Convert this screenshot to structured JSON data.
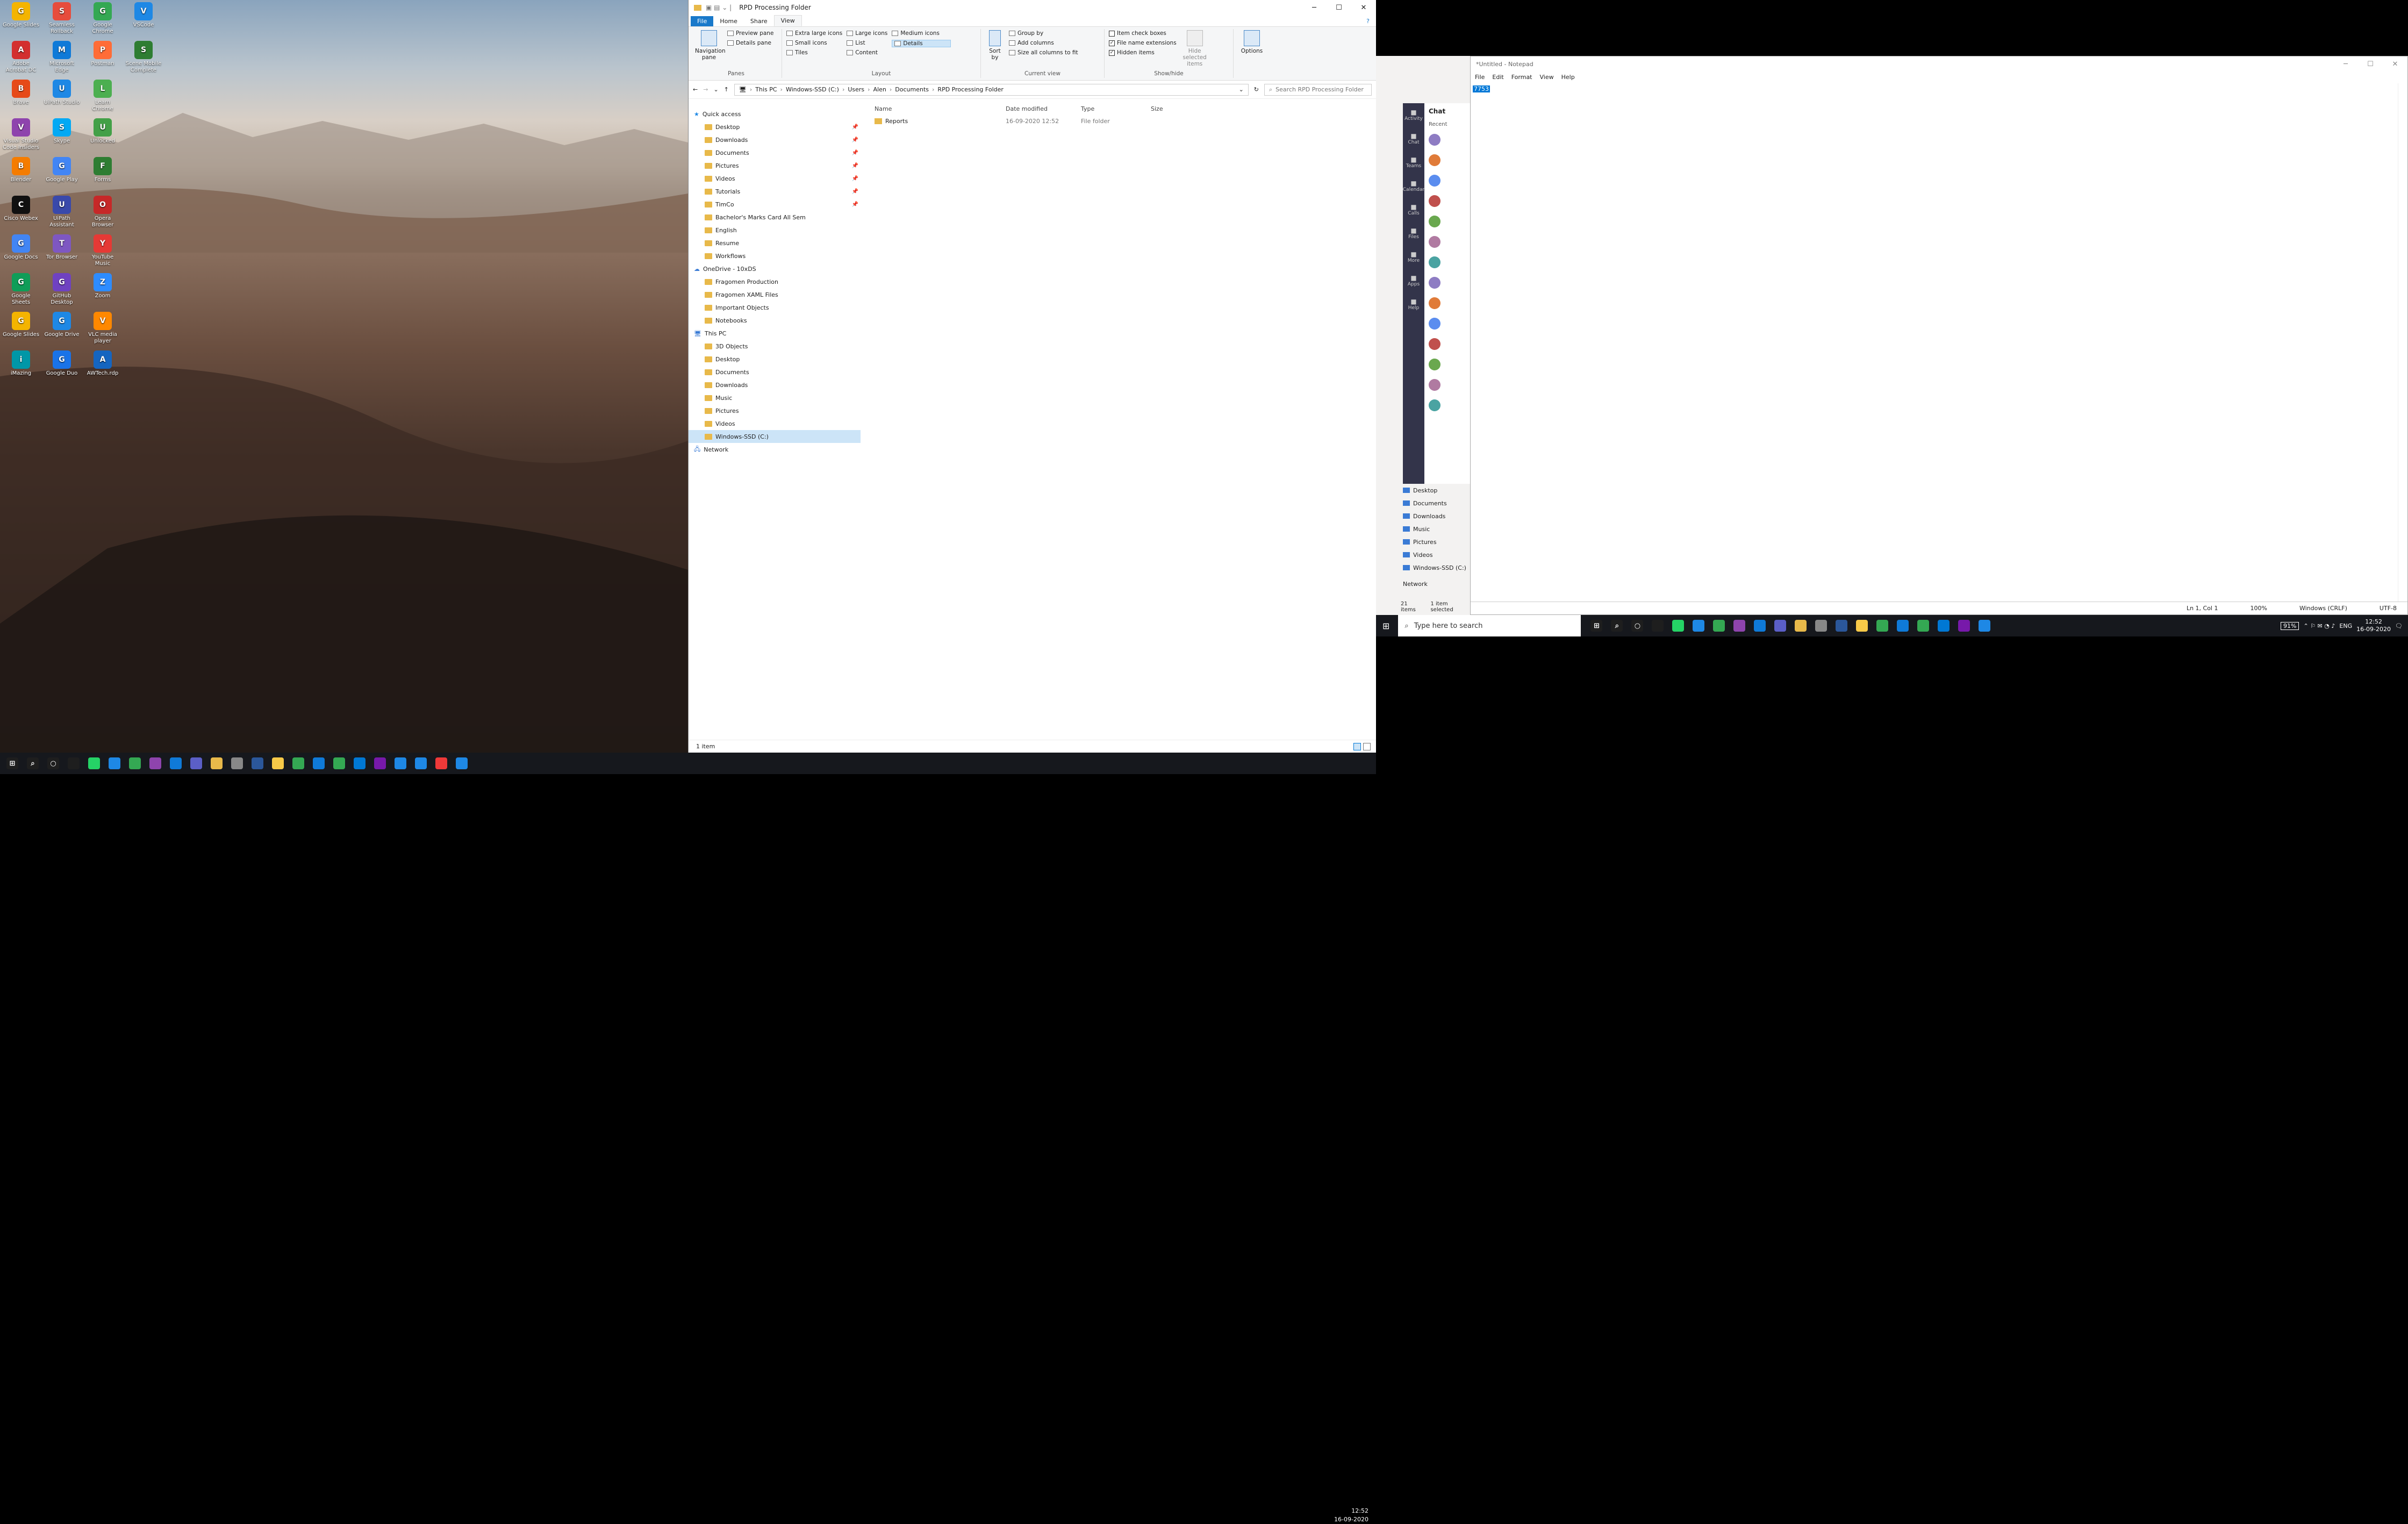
{
  "desktop": {
    "icons": [
      {
        "label": "Google Slides",
        "color": "#f4b400"
      },
      {
        "label": "Seamless Rollback",
        "color": "#e74c3c"
      },
      {
        "label": "Google Chrome",
        "color": "#34a853"
      },
      {
        "label": "VSCode",
        "color": "#1e88e5"
      },
      {
        "label": "Adobe Acrobat DC",
        "color": "#d32f2f"
      },
      {
        "label": "Microsoft Edge",
        "color": "#0f7ad8"
      },
      {
        "label": "Postman",
        "color": "#ff6c37"
      },
      {
        "label": "Scene Mobile Complete",
        "color": "#2e7d32"
      },
      {
        "label": "Brave",
        "color": "#e64a19"
      },
      {
        "label": "UiPath Studio",
        "color": "#1e88e5"
      },
      {
        "label": "Learn Chrome",
        "color": "#4caf50"
      },
      {
        "label": "Visual Studio Code Insiders",
        "color": "#8e44ad"
      },
      {
        "label": "Skype",
        "color": "#03a9f4"
      },
      {
        "label": "Unlocked",
        "color": "#43a047"
      },
      {
        "label": "Blender",
        "color": "#f57c00"
      },
      {
        "label": "Google Play",
        "color": "#4285f4"
      },
      {
        "label": "Forms",
        "color": "#2e7d32"
      },
      {
        "label": "Cisco Webex",
        "color": "#111"
      },
      {
        "label": "UiPath Assistant",
        "color": "#3949ab"
      },
      {
        "label": "Opera Browser",
        "color": "#c62828"
      },
      {
        "label": "Google Docs",
        "color": "#4285f4"
      },
      {
        "label": "Tor Browser",
        "color": "#7e57c2"
      },
      {
        "label": "YouTube Music",
        "color": "#e53935"
      },
      {
        "label": "Google Sheets",
        "color": "#0f9d58"
      },
      {
        "label": "GitHub Desktop",
        "color": "#6f42c1"
      },
      {
        "label": "Zoom",
        "color": "#2d8cff"
      },
      {
        "label": "Google Slides",
        "color": "#f4b400"
      },
      {
        "label": "Google Drive",
        "color": "#1e88e5"
      },
      {
        "label": "VLC media player",
        "color": "#ff8800"
      },
      {
        "label": "iMazing",
        "color": "#0097a7"
      },
      {
        "label": "Google Duo",
        "color": "#1a73e8"
      },
      {
        "label": "AWTech.rdp",
        "color": "#1565c0"
      }
    ]
  },
  "taskbar1": {
    "icons": [
      "windows-icon",
      "search-icon",
      "cortana-icon",
      "taskview-icon",
      "whatsapp-icon",
      "uipath-icon",
      "chrome-icon",
      "vs-icon",
      "vscode-icon",
      "teams-icon",
      "explorer-icon",
      "app-icon",
      "word-icon",
      "sticky-icon",
      "chrome-icon",
      "edge-icon",
      "chrome-icon",
      "outlook-icon",
      "onenote-icon",
      "uipath-icon",
      "uipath-icon",
      "vivaldi-icon",
      "uipath-icon"
    ],
    "time": "12:52",
    "date": "16-09-2020"
  },
  "explorer": {
    "title": "RPD Processing Folder",
    "tabs": [
      "File",
      "Home",
      "Share",
      "View"
    ],
    "ribbon": {
      "panes": {
        "nav": "Navigation pane",
        "preview": "Preview pane",
        "details": "Details pane",
        "label": "Panes"
      },
      "layout": {
        "items": [
          "Extra large icons",
          "Large icons",
          "Medium icons",
          "Small icons",
          "List",
          "Details",
          "Tiles",
          "Content"
        ],
        "label": "Layout"
      },
      "sort": "Sort by",
      "current": {
        "group": "Group by",
        "add": "Add columns",
        "size": "Size all columns to fit",
        "label": "Current view"
      },
      "showhide": {
        "item_check": "Item check boxes",
        "ext": "File name extensions",
        "hidden": "Hidden items",
        "hide_sel": "Hide selected items",
        "label": "Show/hide"
      },
      "options": "Options"
    },
    "path": [
      "This PC",
      "Windows-SSD (C:)",
      "Users",
      "Alen",
      "Documents",
      "RPD Processing Folder"
    ],
    "search_placeholder": "Search RPD Processing Folder",
    "nav": {
      "quick": "Quick access",
      "quick_items": [
        "Desktop",
        "Downloads",
        "Documents",
        "Pictures",
        "Videos",
        "Tutorials",
        "TimCo",
        "Bachelor's Marks Card All Sem",
        "English",
        "Resume",
        "Workflows"
      ],
      "onedrive": "OneDrive - 10xDS",
      "onedrive_items": [
        "Fragomen Production",
        "Fragomen XAML Files",
        "Important Objects",
        "Notebooks"
      ],
      "thispc": "This PC",
      "pc_items": [
        "3D Objects",
        "Desktop",
        "Documents",
        "Downloads",
        "Music",
        "Pictures",
        "Videos",
        "Windows-SSD (C:)"
      ],
      "network": "Network"
    },
    "columns": [
      "Name",
      "Date modified",
      "Type",
      "Size"
    ],
    "rows": [
      {
        "name": "Reports",
        "date": "16-09-2020 12:52",
        "type": "File folder",
        "size": ""
      }
    ],
    "status": "1 item"
  },
  "teams": {
    "chat": "Chat",
    "recent": "Recent",
    "rail": [
      "Activity",
      "Chat",
      "Teams",
      "Calendar",
      "Calls",
      "Files",
      "More",
      "Apps",
      "Help"
    ]
  },
  "sidepanel": {
    "items": [
      "Desktop",
      "Documents",
      "Downloads",
      "Music",
      "Pictures",
      "Videos",
      "Windows-SSD (C:)"
    ],
    "network": "Network",
    "status_left": "21 items",
    "status_right": "1 item selected"
  },
  "notepad": {
    "title": "*Untitled - Notepad",
    "menu": [
      "File",
      "Edit",
      "Format",
      "View",
      "Help"
    ],
    "content": "7753",
    "status": {
      "pos": "Ln 1, Col 1",
      "zoom": "100%",
      "eol": "Windows (CRLF)",
      "enc": "UTF-8"
    }
  },
  "taskbar2": {
    "search": "Type here to search",
    "time": "12:52",
    "date": "16-09-2020",
    "lang": "ENG",
    "battery": "91%"
  }
}
